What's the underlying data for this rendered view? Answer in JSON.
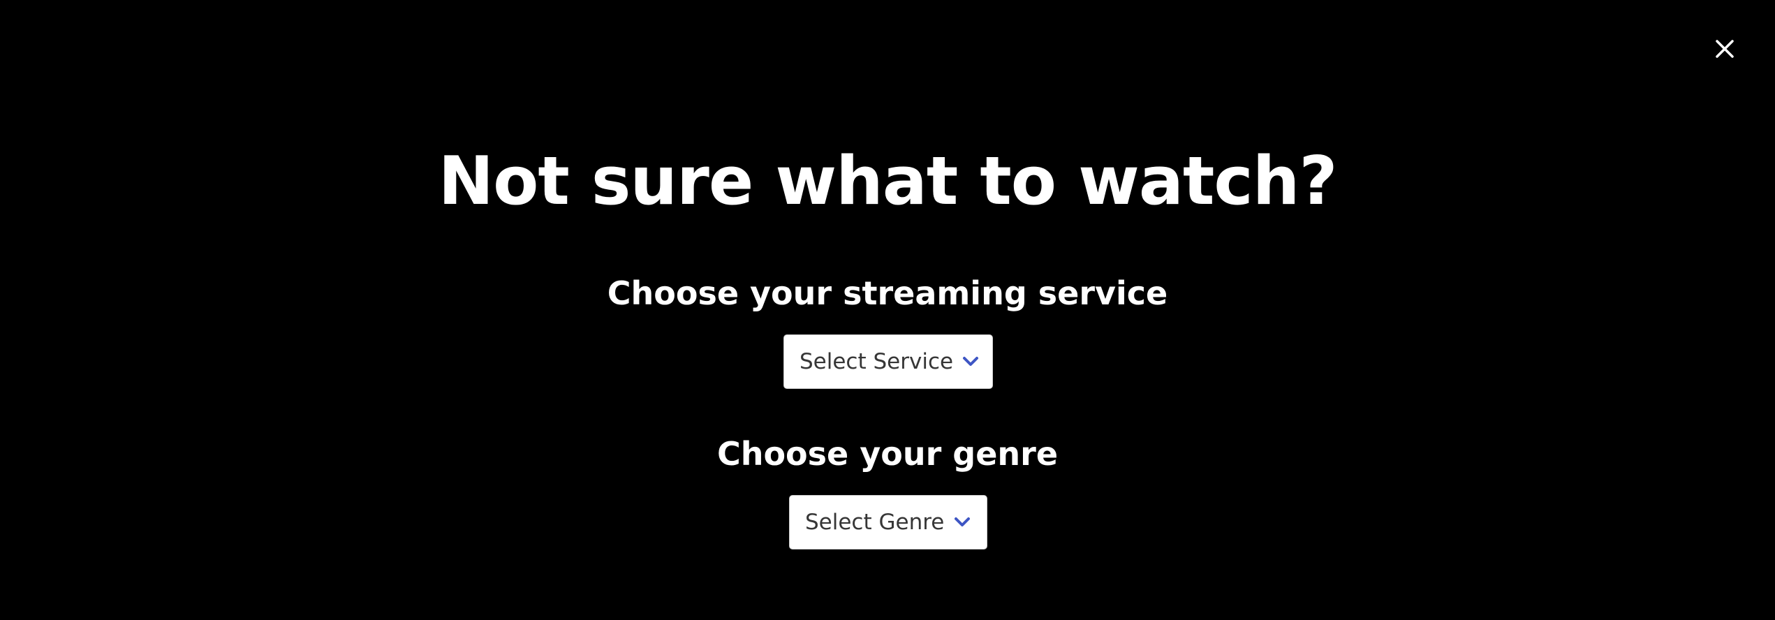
{
  "modal": {
    "title": "Not sure what to watch?",
    "close_icon": "close-icon"
  },
  "service": {
    "label": "Choose your streaming service",
    "select_value": "Select Service",
    "chevron_icon": "chevron-down-icon"
  },
  "genre": {
    "label": "Choose your genre",
    "select_value": "Select Genre",
    "chevron_icon": "chevron-down-icon"
  },
  "colors": {
    "background": "#000000",
    "text": "#ffffff",
    "select_bg": "#ffffff",
    "select_text": "#363636",
    "accent": "#3e56c4"
  }
}
